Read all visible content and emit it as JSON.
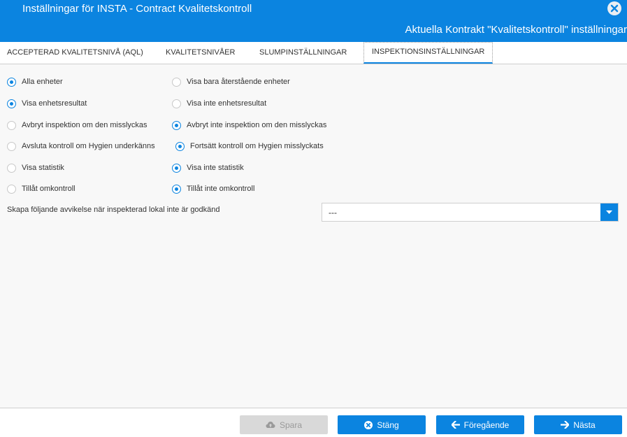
{
  "header": {
    "title": "Inställningar för INSTA - Contract Kvalitetskontroll",
    "subtitle": "Aktuella Kontrakt \"Kvalitetskontroll\" inställningar"
  },
  "tabs": [
    {
      "label": "ACCEPTERAD KVALITETSNIVÅ (AQL)",
      "active": false
    },
    {
      "label": "KVALITETSNIVÅER",
      "active": false
    },
    {
      "label": "SLUMPINSTÄLLNINGAR",
      "active": false
    },
    {
      "label": "INSPEKTIONSINSTÄLLNINGAR",
      "active": true
    }
  ],
  "options": [
    {
      "left": {
        "label": "Alla enheter",
        "checked": true
      },
      "right": {
        "label": "Visa bara återstående enheter",
        "checked": false
      }
    },
    {
      "left": {
        "label": "Visa enhetsresultat",
        "checked": true
      },
      "right": {
        "label": "Visa inte enhetsresultat",
        "checked": false
      }
    },
    {
      "left": {
        "label": "Avbryt inspektion om den misslyckas",
        "checked": false
      },
      "right": {
        "label": "Avbryt inte inspektion om den misslyckas",
        "checked": true
      }
    },
    {
      "left": {
        "label": "Avsluta kontroll om Hygien underkänns",
        "checked": false
      },
      "right": {
        "label": "Fortsätt kontroll om Hygien misslyckats",
        "checked": true
      }
    },
    {
      "left": {
        "label": "Visa statistik",
        "checked": false
      },
      "right": {
        "label": "Visa inte statistik",
        "checked": true
      }
    },
    {
      "left": {
        "label": "Tillåt omkontroll",
        "checked": false
      },
      "right": {
        "label": "Tillåt inte omkontroll",
        "checked": true
      }
    }
  ],
  "deviation": {
    "label": "Skapa följande avvikelse när inspekterad lokal inte är godkänd",
    "value": "---"
  },
  "footer": {
    "save_label": "Spara",
    "close_label": "Stäng",
    "prev_label": "Föregående",
    "next_label": "Nästa"
  },
  "colors": {
    "accent": "#0b84e0",
    "disabled": "#d9d9d9"
  },
  "icons": {
    "save": "cloud-upload-icon",
    "close": "times-circle-icon",
    "prev": "arrow-left-icon",
    "next": "arrow-right-icon",
    "header_close": "close-icon",
    "dropdown": "caret-down-icon"
  }
}
